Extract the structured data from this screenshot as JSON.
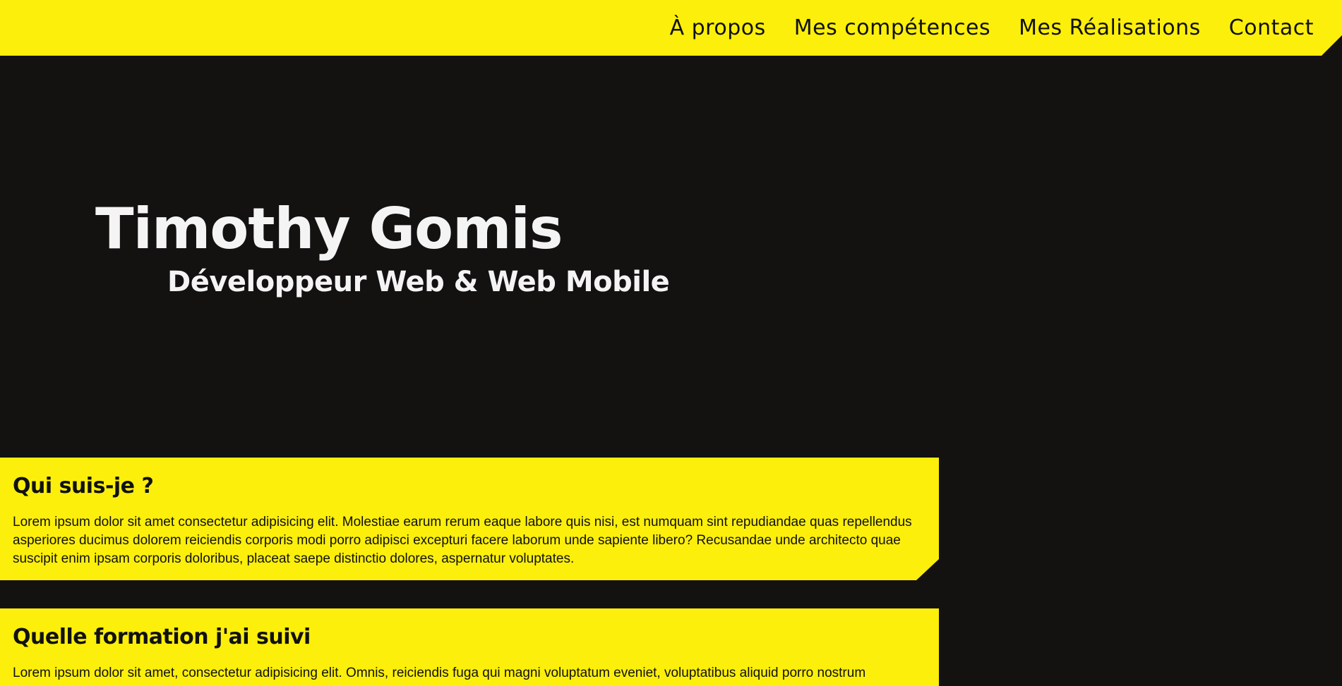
{
  "nav": {
    "items": [
      {
        "label": "À propos"
      },
      {
        "label": "Mes compétences"
      },
      {
        "label": "Mes Réalisations"
      },
      {
        "label": "Contact"
      }
    ]
  },
  "hero": {
    "name": "Timothy Gomis",
    "subtitle": "Développeur Web & Web Mobile"
  },
  "sections": [
    {
      "title": "Qui suis-je ?",
      "text": "Lorem ipsum dolor sit amet consectetur adipisicing elit. Molestiae earum rerum eaque labore quis nisi, est numquam sint repudiandae quas repellendus asperiores ducimus dolorem reiciendis corporis modi porro adipisci excepturi facere laborum unde sapiente libero? Recusandae unde architecto quae suscipit enim ipsam corporis doloribus, placeat saepe distinctio dolores, aspernatur voluptates."
    },
    {
      "title": "Quelle formation j'ai suivi",
      "text": "Lorem ipsum dolor sit amet, consectetur adipisicing elit. Omnis, reiciendis fuga qui magni voluptatum eveniet, voluptatibus aliquid porro nostrum"
    }
  ],
  "colors": {
    "accent": "#fcef0b",
    "background": "#141111",
    "hero_text": "#f4f4f4",
    "text": "#111111"
  }
}
